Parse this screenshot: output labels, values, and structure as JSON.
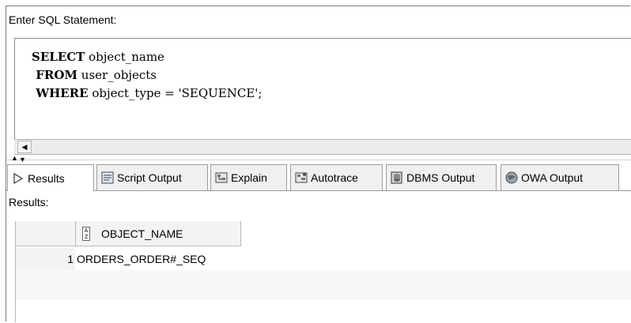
{
  "sql_panel": {
    "label": "Enter SQL Statement:",
    "lines": [
      {
        "keyword": "SELECT",
        "rest": " object_name"
      },
      {
        "keyword": " FROM",
        "rest": " user_objects"
      },
      {
        "keyword": " WHERE",
        "rest": " object_type = 'SEQUENCE';"
      }
    ]
  },
  "tabs": [
    {
      "label": "Results",
      "icon": "play-icon",
      "active": true
    },
    {
      "label": "Script Output",
      "icon": "script-output-icon"
    },
    {
      "label": "Explain",
      "icon": "explain-icon"
    },
    {
      "label": "Autotrace",
      "icon": "autotrace-icon"
    },
    {
      "label": "DBMS Output",
      "icon": "dbms-output-icon"
    },
    {
      "label": "OWA Output",
      "icon": "owa-output-icon"
    }
  ],
  "results": {
    "label": "Results:",
    "columns": [
      "OBJECT_NAME"
    ],
    "rows": [
      {
        "num": "1",
        "values": [
          "ORDERS_ORDER#_SEQ"
        ]
      }
    ]
  }
}
